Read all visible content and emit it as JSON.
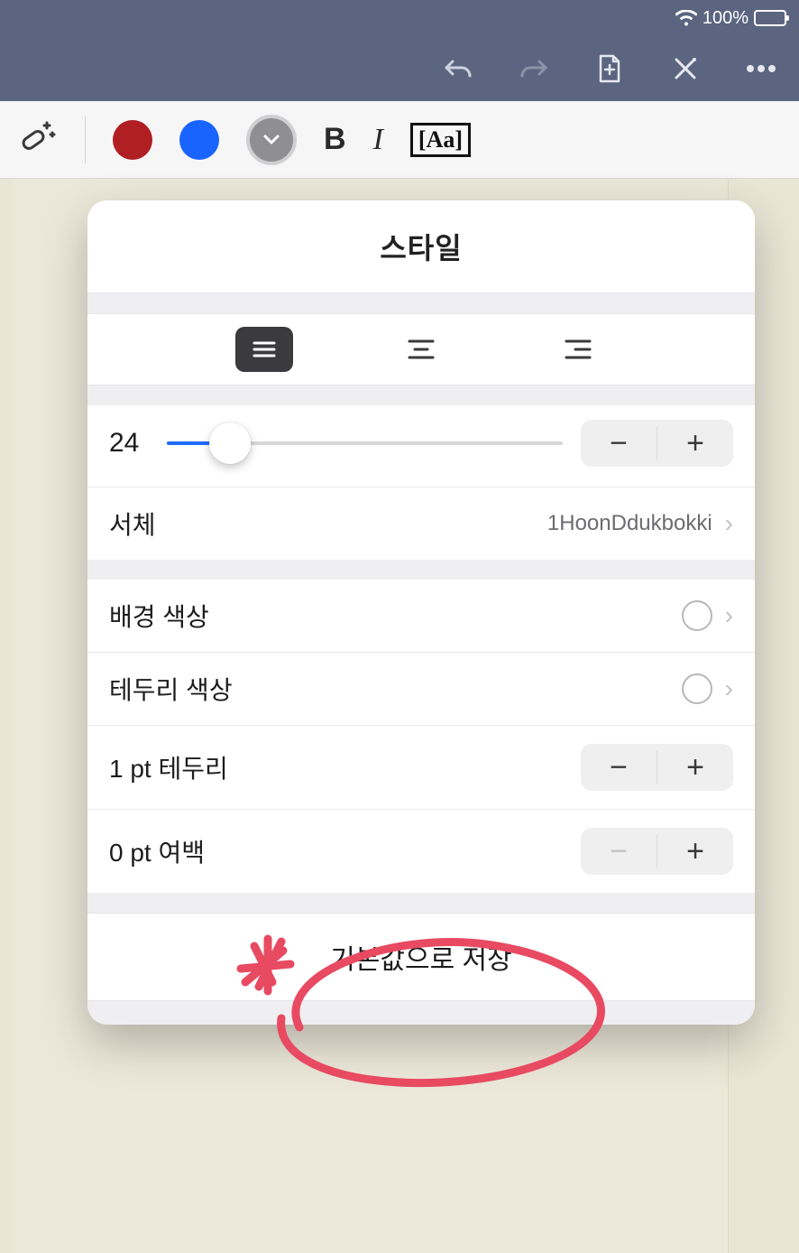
{
  "status": {
    "battery_text": "100%"
  },
  "toolbar": {
    "bold_glyph": "B",
    "italic_glyph": "I",
    "style_glyph": "Aa"
  },
  "popover": {
    "title": "스타일",
    "font_size": "24",
    "font_label": "서체",
    "font_value": "1HoonDdukbokki",
    "bg_color_label": "배경 색상",
    "border_color_label": "테두리 색상",
    "border_size_label": "1 pt 테두리",
    "padding_label": "0 pt 여백",
    "save_default_label": "기본값으로 저장"
  }
}
